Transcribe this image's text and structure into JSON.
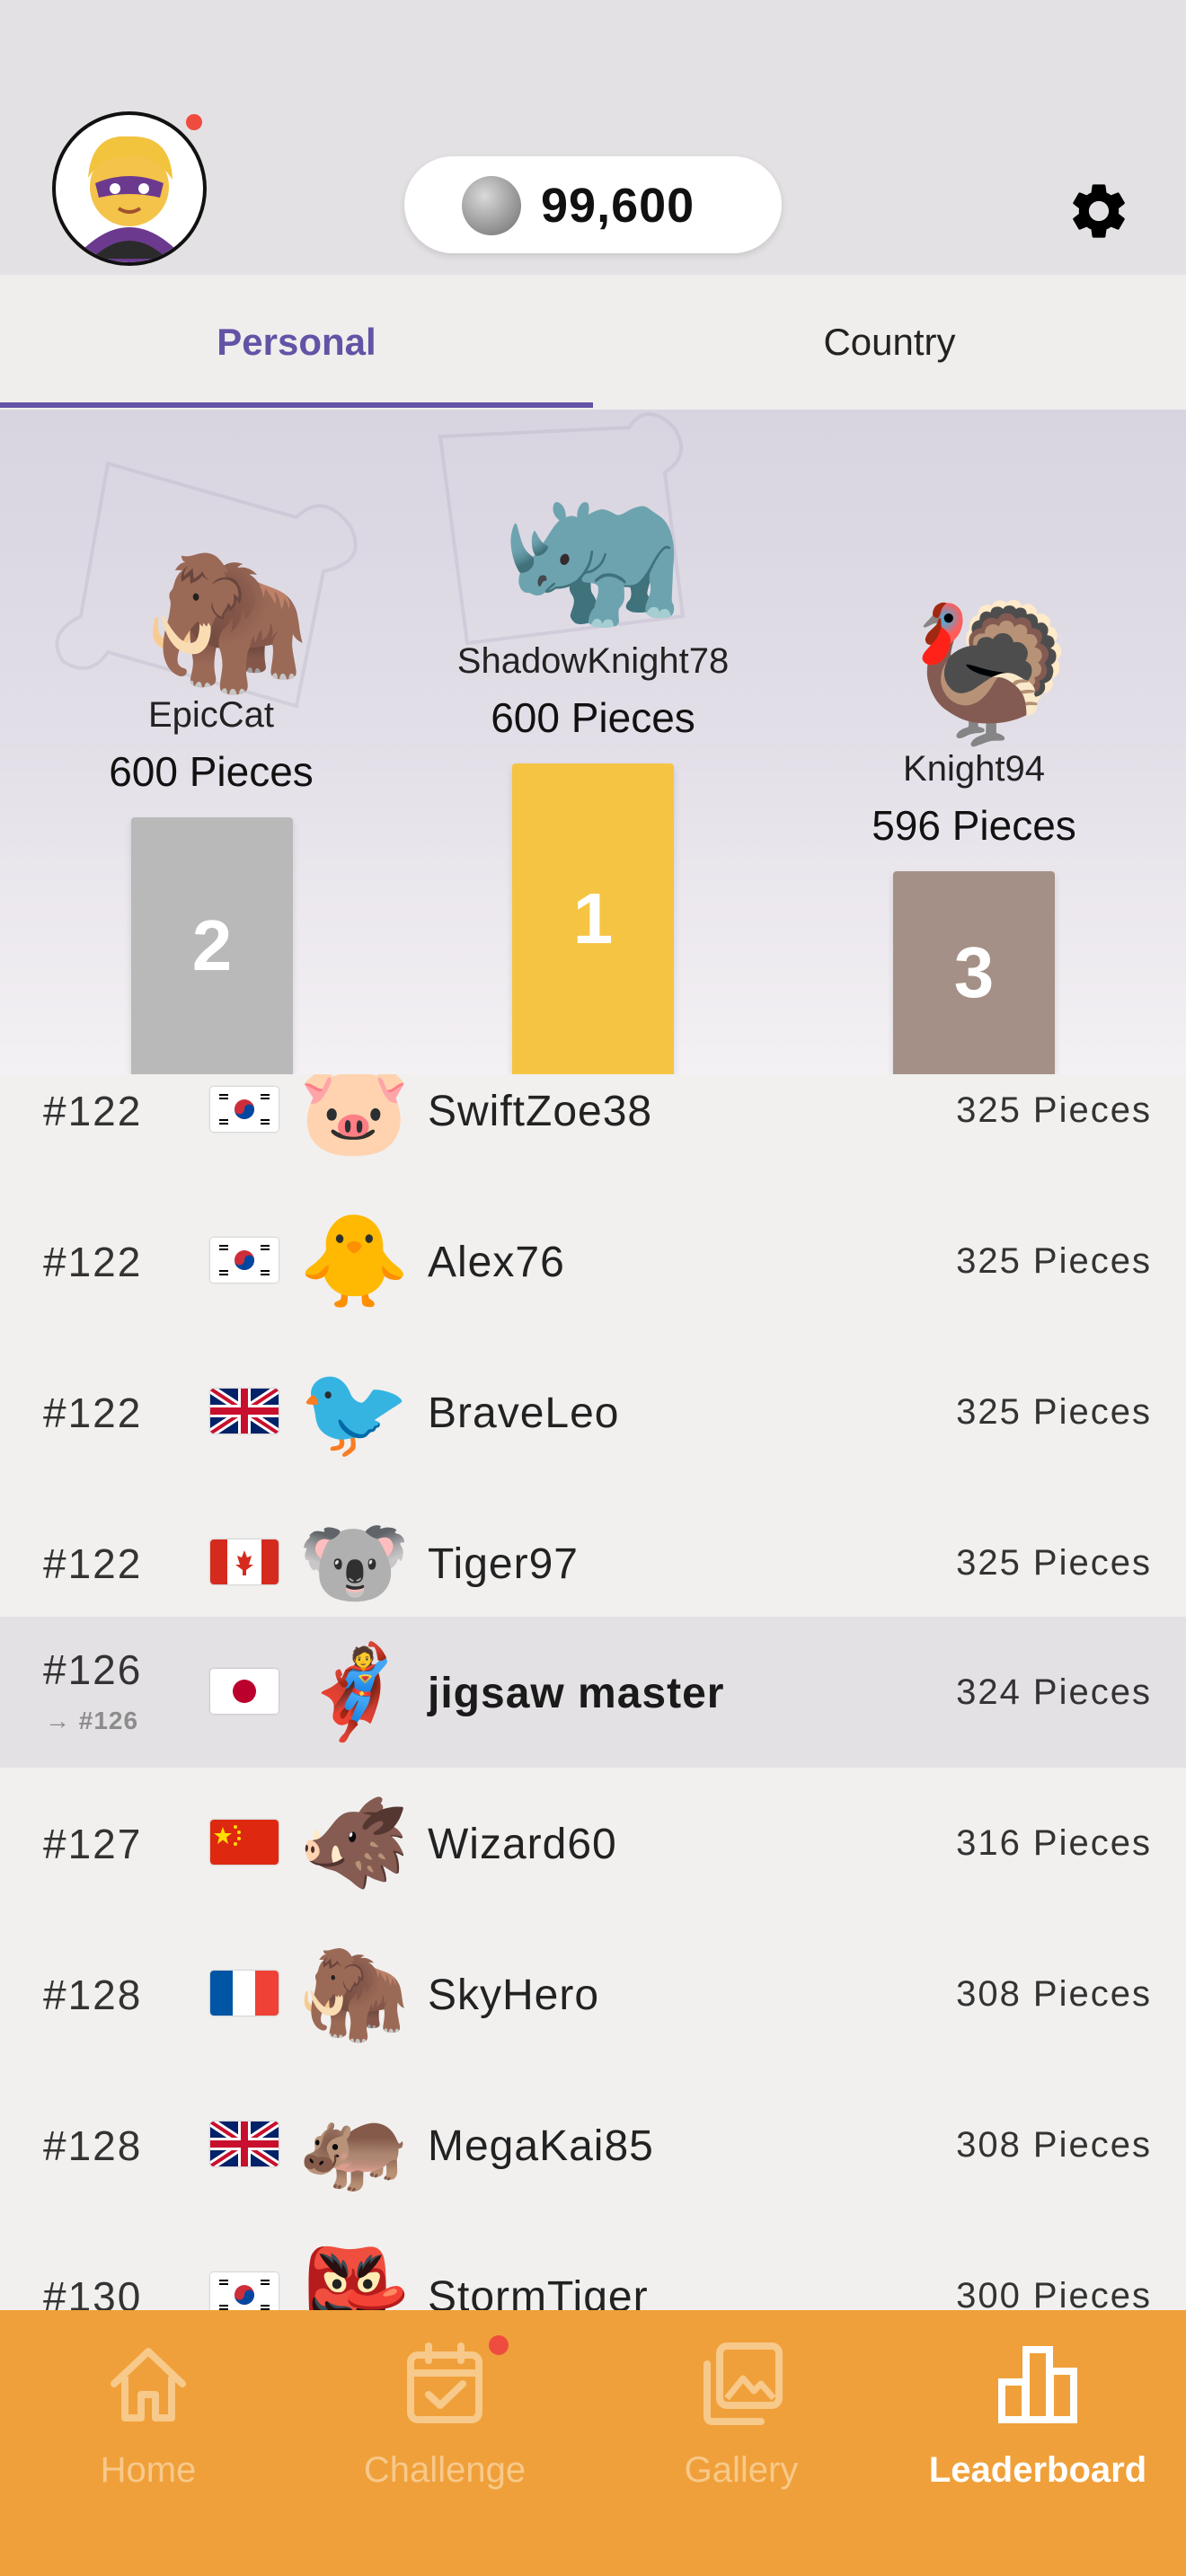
{
  "header": {
    "coins": "99,600",
    "icons": {
      "avatar": "superhero-avatar",
      "coin": "coin-icon",
      "settings": "gear-icon"
    }
  },
  "tabs": [
    {
      "label": "Personal",
      "active": true
    },
    {
      "label": "Country",
      "active": false
    }
  ],
  "podium": [
    {
      "place": "1",
      "name": "ShadowKnight78",
      "pieces": "600 Pieces",
      "emoji": "🦏",
      "color": "#f5c443"
    },
    {
      "place": "2",
      "name": "EpicCat",
      "pieces": "600 Pieces",
      "emoji": "🦣",
      "color": "#b9b9b9"
    },
    {
      "place": "3",
      "name": "Knight94",
      "pieces": "596 Pieces",
      "emoji": "🦃",
      "color": "#a49086"
    }
  ],
  "leaderboard": [
    {
      "rank": "#122",
      "flag": "KR",
      "emoji": "🐷",
      "name": "SwiftZoe38",
      "pieces": "325 Pieces"
    },
    {
      "rank": "#122",
      "flag": "KR",
      "emoji": "🐥",
      "name": "Alex76",
      "pieces": "325 Pieces"
    },
    {
      "rank": "#122",
      "flag": "GB",
      "emoji": "🐦",
      "name": "BraveLeo",
      "pieces": "325 Pieces"
    },
    {
      "rank": "#122",
      "flag": "CA",
      "emoji": "🐨",
      "name": "Tiger97",
      "pieces": "325 Pieces"
    },
    {
      "rank": "#126",
      "rank_change": "→ #126",
      "flag": "JP",
      "emoji": "🦸",
      "name": "jigsaw master",
      "pieces": "324 Pieces",
      "is_me": true
    },
    {
      "rank": "#127",
      "flag": "CN",
      "emoji": "🐗",
      "name": "Wizard60",
      "pieces": "316 Pieces"
    },
    {
      "rank": "#128",
      "flag": "FR",
      "emoji": "🦣",
      "name": "SkyHero",
      "pieces": "308 Pieces"
    },
    {
      "rank": "#128",
      "flag": "GB",
      "emoji": "🦛",
      "name": "MegaKai85",
      "pieces": "308 Pieces"
    },
    {
      "rank": "#130",
      "flag": "KR",
      "emoji": "👺",
      "name": "StormTiger",
      "pieces": "300 Pieces"
    }
  ],
  "nav": [
    {
      "label": "Home",
      "icon": "house-icon",
      "active": false
    },
    {
      "label": "Challenge",
      "icon": "calendar-check-icon",
      "active": false,
      "badge": true
    },
    {
      "label": "Gallery",
      "icon": "gallery-icon",
      "active": false
    },
    {
      "label": "Leaderboard",
      "icon": "bar-chart-icon",
      "active": true
    }
  ],
  "colors": {
    "accent": "#6452a6",
    "nav_bg": "#f0a03a",
    "badge": "#ee4c3f"
  }
}
